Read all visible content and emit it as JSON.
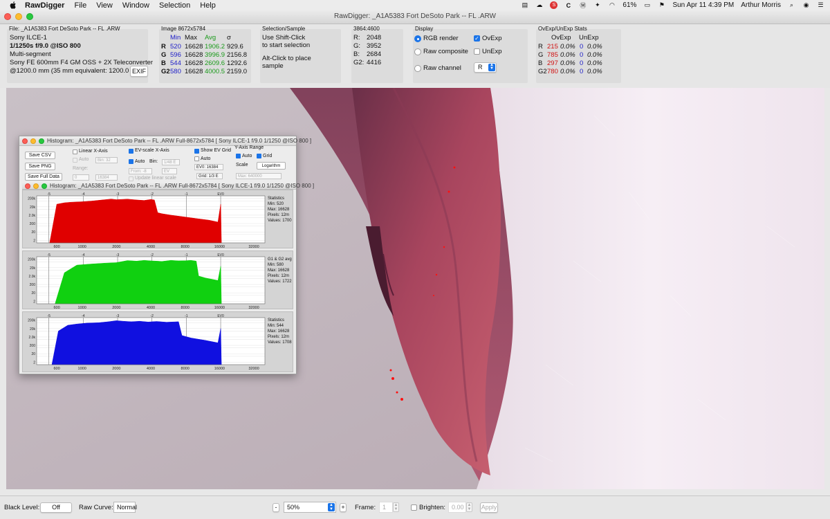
{
  "menubar": {
    "app_name": "RawDigger",
    "items": [
      "File",
      "View",
      "Window",
      "Selection",
      "Help"
    ],
    "battery": "61%",
    "datetime": "Sun Apr 11  4:39 PM",
    "user": "Arthur Morris"
  },
  "window": {
    "title": "RawDigger: _A1A5383 Fort DeSoto Park -- FL .ARW"
  },
  "file_info": {
    "file_label": "File: _A1A5383 Fort DeSoto Park -- FL .ARW",
    "camera": "Sony ILCE-1",
    "exposure": "1/1250s f/9.0 @ISO 800",
    "mode": "Multi-segment",
    "lens": "Sony FE 600mm F4 GM OSS + 2X Teleconverter",
    "focal": "@1200.0 mm (35 mm equivalent: 1200.0 mm",
    "exif_button": "EXIF"
  },
  "image_stats": {
    "title": "Image 8672x5784",
    "headers": [
      "Min",
      "Max",
      "Avg",
      "σ"
    ],
    "rows": [
      {
        "ch": "R",
        "min": "520",
        "max": "16628",
        "avg": "1906.2",
        "sd": "929.6"
      },
      {
        "ch": "G",
        "min": "596",
        "max": "16628",
        "avg": "3996.9",
        "sd": "2156.8"
      },
      {
        "ch": "B",
        "min": "544",
        "max": "16628",
        "avg": "2609.6",
        "sd": "1292.6"
      },
      {
        "ch": "G2",
        "min": "580",
        "max": "16628",
        "avg": "4000.5",
        "sd": "2159.0"
      }
    ]
  },
  "selection": {
    "title": "Selection/Sample",
    "line1": "Use Shift-Click",
    "line2": "to start selection",
    "line3": "Alt-Click to place",
    "line4": "sample"
  },
  "sample": {
    "title": "3864:4600",
    "rows": [
      {
        "ch": "R:",
        "val": "2048"
      },
      {
        "ch": "G:",
        "val": "3952"
      },
      {
        "ch": "B:",
        "val": "2684"
      },
      {
        "ch": "G2:",
        "val": "4416"
      }
    ]
  },
  "display": {
    "title": "Display",
    "rgb_render": "RGB render",
    "raw_composite": "Raw composite",
    "raw_channel": "Raw channel",
    "ovexp": "OvExp",
    "unexp": "UnExp",
    "channel_select": "R"
  },
  "ovexp_stats": {
    "title": "OvExp/UnExp Stats",
    "headers": [
      "OvExp",
      "UnExp"
    ],
    "rows": [
      {
        "ch": "R",
        "ov_n": "215",
        "ov_p": "0.0%",
        "un_n": "0",
        "un_p": "0.0%"
      },
      {
        "ch": "G",
        "ov_n": "785",
        "ov_p": "0.0%",
        "un_n": "0",
        "un_p": "0.0%"
      },
      {
        "ch": "B",
        "ov_n": "297",
        "ov_p": "0.0%",
        "un_n": "0",
        "un_p": "0.0%"
      },
      {
        "ch": "G2",
        "ov_n": "780",
        "ov_p": "0.0%",
        "un_n": "0",
        "un_p": "0.0%"
      }
    ]
  },
  "histogram_window": {
    "title": "Histogram: _A1A5383 Fort DeSoto Park -- FL .ARW Full-8672x5784 [ Sony ILCE-1 f/9.0 1/1250 @ISO 800 ]",
    "title_front": "Histogram: _A1A5383 Fort DeSoto Park -- FL .ARW Full-8672x5784 [ Sony ILCE-1 f/9.0 1/1250 @ISO 800 ]",
    "save_csv": "Save CSV",
    "save_png": "Save PNG",
    "save_full": "Save Full Data",
    "linear_x": "Linear X-Axis",
    "auto": "Auto",
    "bin_ph": "Bin: 32",
    "range": "Range:",
    "range_from": "0",
    "range_to": "16384",
    "ev_scale": "EV-scale X-Axis",
    "bin_label": "Bin:",
    "bin_val": "1/48 E",
    "from_val": "From: -8",
    "to_val": "EV",
    "update_linear": "Update linear scale",
    "show_ev_grid": "Show EV Grid",
    "ev0_field": "EV0: 16384",
    "grid_field": "Grid: 1/3 E",
    "y_axis_range": "Y-Axis Range",
    "grid_label": "Grid",
    "scale_label": "Scale",
    "scale_val": "Logarithm",
    "max_field": "Max: 640000"
  },
  "chart_data": [
    {
      "type": "area",
      "name": "R",
      "color": "#e00000",
      "x_ticks": [
        "600",
        "1000",
        "2000",
        "4000",
        "8000",
        "16000",
        "32000"
      ],
      "ev_ticks": [
        "-5",
        "-4",
        "-3",
        "-2",
        "-1",
        "EV0"
      ],
      "y_ticks": [
        "200k",
        "100k",
        "20k",
        "10k",
        "2.0k",
        "1.0k",
        "200",
        "100",
        "20",
        "10",
        "2",
        "1"
      ],
      "x": [
        520,
        600,
        700,
        800,
        1000,
        1200,
        1500,
        1800,
        2000,
        2500,
        3000,
        3500,
        4000,
        4300,
        4600,
        5000,
        6000,
        8000,
        10000,
        13000,
        15500,
        16400,
        16628
      ],
      "y": [
        1,
        40000,
        60000,
        70000,
        80000,
        95000,
        130000,
        165000,
        140000,
        160000,
        130000,
        115000,
        150000,
        130000,
        4000,
        3000,
        2000,
        1200,
        800,
        500,
        300,
        40000,
        1
      ],
      "stats": "Statistics\nMin: 520\nMax: 16628\nPixels: 12m\nValues: 1700"
    },
    {
      "type": "area",
      "name": "G1 & G2 avg",
      "color": "#10d010",
      "x_ticks": [
        "600",
        "1000",
        "2000",
        "4000",
        "8000",
        "16000",
        "32000"
      ],
      "ev_ticks": [
        "-5",
        "-4",
        "-3",
        "-2",
        "-1",
        "EV0"
      ],
      "y_ticks": [
        "200k",
        "100k",
        "20k",
        "10k",
        "2.0k",
        "1.0k",
        "200",
        "100",
        "20",
        "10",
        "2",
        "1"
      ],
      "x": [
        580,
        700,
        900,
        1200,
        1600,
        2000,
        2500,
        3000,
        3500,
        4000,
        4500,
        5000,
        6000,
        7000,
        8000,
        9000,
        10000,
        10500,
        12000,
        15500,
        16400,
        16628
      ],
      "y": [
        1,
        5000,
        40000,
        55000,
        70000,
        80000,
        140000,
        120000,
        150000,
        130000,
        120000,
        110000,
        150000,
        130000,
        135000,
        150000,
        120000,
        2000,
        1200,
        600,
        30000,
        1
      ],
      "stats": "G1 & G2 avg\nMin: 580\nMax: 16628\nPixels: 12m\nValues: 1722"
    },
    {
      "type": "area",
      "name": "B",
      "color": "#1010e0",
      "x_ticks": [
        "600",
        "1000",
        "2000",
        "4000",
        "8000",
        "16000",
        "32000"
      ],
      "ev_ticks": [
        "-5",
        "-4",
        "-3",
        "-2",
        "-1",
        "EV0"
      ],
      "y_ticks": [
        "200k",
        "100k",
        "20k",
        "10k",
        "2.0k",
        "1.0k",
        "200",
        "100",
        "20",
        "10",
        "2",
        "1"
      ],
      "x": [
        544,
        620,
        750,
        900,
        1100,
        1400,
        1700,
        2000,
        2300,
        2700,
        3200,
        3800,
        4500,
        5500,
        6500,
        7000,
        7500,
        9000,
        12000,
        15500,
        16400,
        16628
      ],
      "y": [
        1,
        10000,
        50000,
        70000,
        90000,
        100000,
        130000,
        175000,
        150000,
        130000,
        150000,
        120000,
        140000,
        115000,
        125000,
        130000,
        3000,
        1500,
        800,
        400,
        20000,
        1
      ],
      "stats": "Statistics\nMin: 544\nMax: 16628\nPixels: 12m\nValues: 1708"
    }
  ],
  "bottom": {
    "black_level_label": "Black Level:",
    "black_level_val": "Off",
    "raw_curve_label": "Raw Curve:",
    "raw_curve_val": "Normal",
    "minus": "-",
    "zoom": "50%",
    "plus": "+",
    "frame_label": "Frame:",
    "frame_val": "1",
    "brighten_label": "Brighten:",
    "brighten_val": "0.00",
    "apply": "Apply"
  }
}
